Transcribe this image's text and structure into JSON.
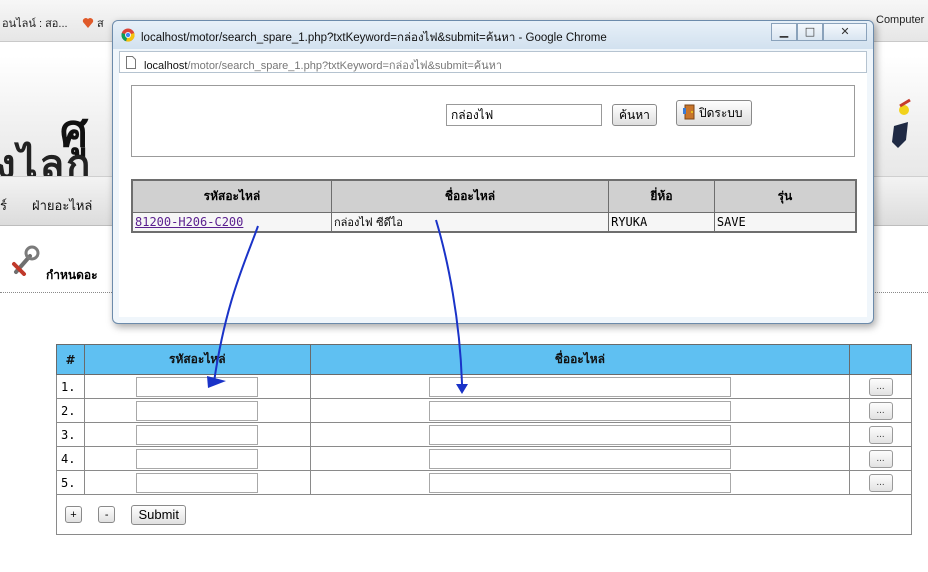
{
  "bookmarks": [
    {
      "label": "อนไลน์ : สอ...",
      "icon": "page-icon"
    },
    {
      "label": "ส",
      "icon": "heart-icon"
    },
    {
      "label": "Computer",
      "icon": "app-icon"
    }
  ],
  "site": {
    "logo_line1": "ศู",
    "logo_line2": "งไลก",
    "nav": [
      "ร์",
      "ฝ่ายอะไหล่"
    ],
    "section_title": "กำหนดอะ"
  },
  "popup": {
    "title": "localhost/motor/search_spare_1.php?txtKeyword=กล่องไฟ&submit=ค้นหา - Google Chrome",
    "url_host": "localhost",
    "url_path": "/motor/search_spare_1.php?txtKeyword=กล่องไฟ&submit=ค้นหา",
    "search_value": "กล่องไฟ",
    "search_button": "ค้นหา",
    "close_button": "ปิดระบบ",
    "headers": [
      "รหัสอะไหล่",
      "ชื่ออะไหล่",
      "ยี่ห้อ",
      "รุ่น"
    ],
    "rows": [
      {
        "code": "81200-H206-C200",
        "name": "กล่องไฟ ซีดีไอ",
        "brand": "RYUKA",
        "model": "SAVE"
      }
    ]
  },
  "main_table": {
    "headers": [
      "#",
      "รหัสอะไหล่",
      "ชื่ออะไหล่",
      ""
    ],
    "rows": [
      {
        "num": "1.",
        "code": "",
        "name": ""
      },
      {
        "num": "2.",
        "code": "",
        "name": ""
      },
      {
        "num": "3.",
        "code": "",
        "name": ""
      },
      {
        "num": "4.",
        "code": "",
        "name": ""
      },
      {
        "num": "5.",
        "code": "",
        "name": ""
      }
    ],
    "lookup_button": "...",
    "add_button": "+",
    "remove_button": "-",
    "submit_button": "Submit"
  },
  "colors": {
    "header_blue": "#5fc0f2",
    "annotation_arrow": "#1a33c8",
    "link": "#5a1f8f"
  }
}
